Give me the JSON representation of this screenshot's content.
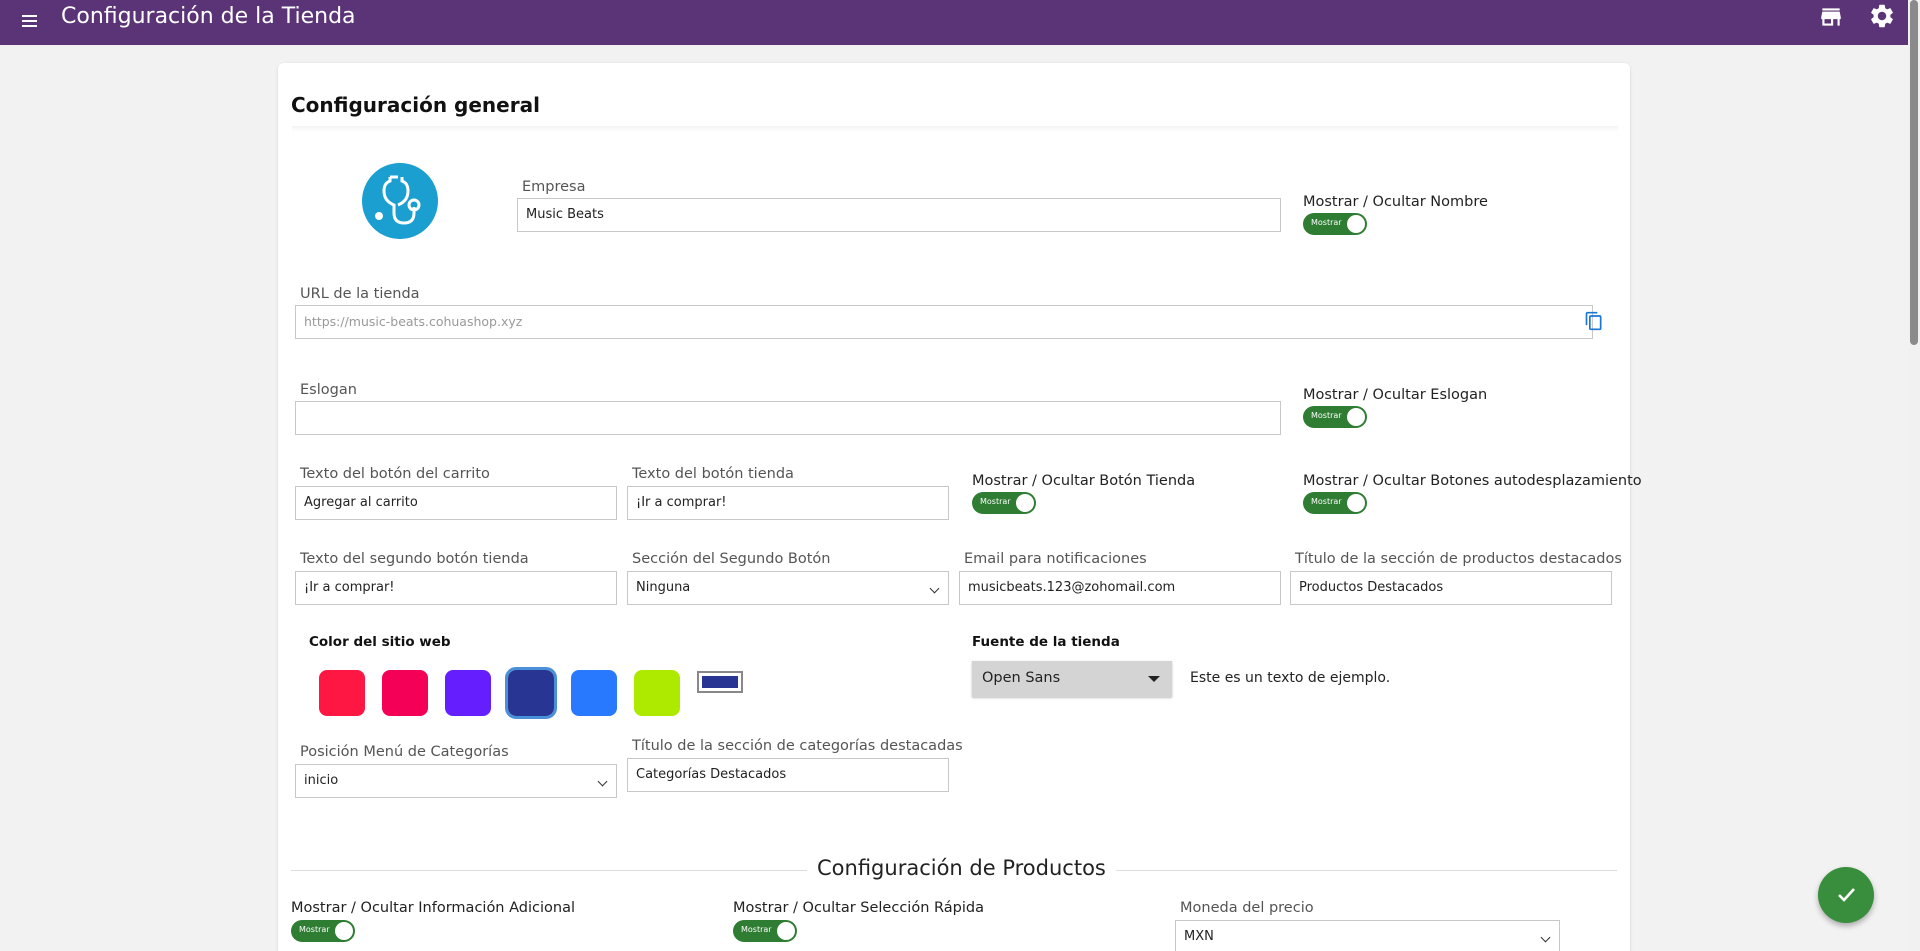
{
  "topbar": {
    "title": "Configuración de la Tienda",
    "menu_icon": "menu-icon",
    "store_icon": "store-icon",
    "settings_icon": "gear-icon"
  },
  "card": {
    "title": "Configuración general"
  },
  "logo": {
    "icon": "stethoscope-icon",
    "color": "#1a9fd0"
  },
  "fields": {
    "empresa": {
      "label": "Empresa",
      "value": "Music Beats"
    },
    "url": {
      "label": "URL de la tienda",
      "value": "https://music-beats.cohuashop.xyz"
    },
    "eslogan": {
      "label": "Eslogan",
      "value": ""
    },
    "texto_carrito": {
      "label": "Texto del botón del carrito",
      "value": "Agregar al carrito"
    },
    "texto_tienda": {
      "label": "Texto del botón tienda",
      "value": "¡Ir a comprar!"
    },
    "texto_segundo": {
      "label": "Texto del segundo botón tienda",
      "value": "¡Ir a comprar!"
    },
    "seccion_segundo": {
      "label": "Sección del Segundo Botón",
      "value": "Ninguna"
    },
    "email": {
      "label": "Email para notificaciones",
      "value": "musicbeats.123@zohomail.com"
    },
    "titulo_destacados": {
      "label": "Título de la sección de productos destacados",
      "value": "Productos Destacados"
    },
    "posicion_menu": {
      "label": "Posición Menú de Categorías",
      "value": "inicio"
    },
    "titulo_categorias": {
      "label": "Título de la sección de categorías destacadas",
      "value": "Categorías Destacados"
    },
    "moneda": {
      "label": "Moneda del precio",
      "value": "MXN"
    }
  },
  "toggles": {
    "nombre": {
      "label": "Mostrar / Ocultar Nombre",
      "state": "Mostrar"
    },
    "eslogan": {
      "label": "Mostrar / Ocultar Eslogan",
      "state": "Mostrar"
    },
    "boton_tienda": {
      "label": "Mostrar / Ocultar Botón Tienda",
      "state": "Mostrar"
    },
    "autodesplazamiento": {
      "label": "Mostrar / Ocultar Botones autodesplazamiento",
      "state": "Mostrar"
    },
    "info_adicional": {
      "label": "Mostrar / Ocultar Información Adicional",
      "state": "Mostrar"
    },
    "seleccion_rapida": {
      "label": "Mostrar / Ocultar Selección Rápida",
      "state": "Mostrar"
    }
  },
  "colors": {
    "label": "Color del sitio web",
    "swatches": [
      "#ff1744",
      "#f50057",
      "#651fff",
      "#283593",
      "#2979ff",
      "#aeea00"
    ],
    "custom": "#283593"
  },
  "font": {
    "label": "Fuente de la tienda",
    "value": "Open Sans",
    "sample": "Este es un texto de ejemplo."
  },
  "productos": {
    "title": "Configuración de Productos"
  },
  "theme": {
    "topbar": "#5a3477",
    "toggle_on": "#2e7d32",
    "fab": "#388e3c"
  },
  "icons": {
    "copy": "copy-icon",
    "save": "check-icon"
  }
}
